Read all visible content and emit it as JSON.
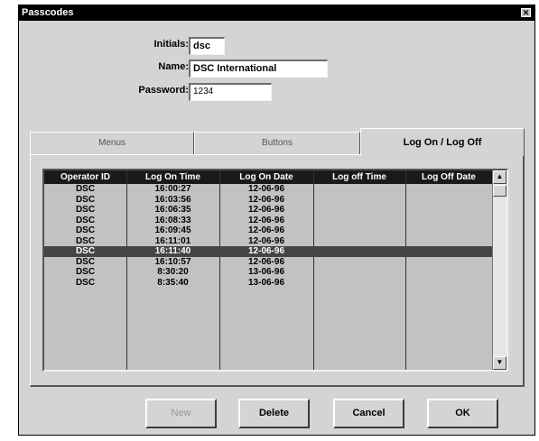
{
  "window": {
    "title": "Passcodes",
    "close_glyph": "✕"
  },
  "form": {
    "initials_label": "Initials:",
    "initials_value": "dsc",
    "name_label": "Name:",
    "name_value": "DSC International",
    "password_label": "Password:",
    "password_value": "1234"
  },
  "tabs": [
    {
      "label": "Menus",
      "active": false
    },
    {
      "label": "Buttons",
      "active": false
    },
    {
      "label": "Log On / Log Off",
      "active": true
    }
  ],
  "grid": {
    "columns": [
      "Operator ID",
      "Log On Time",
      "Log On Date",
      "Log off Time",
      "Log Off Date"
    ],
    "rows": [
      [
        "DSC",
        "16:00:27",
        "12-06-96",
        "",
        ""
      ],
      [
        "DSC",
        "16:03:56",
        "12-06-96",
        "",
        ""
      ],
      [
        "DSC",
        "16:06:35",
        "12-06-96",
        "",
        ""
      ],
      [
        "DSC",
        "16:08:33",
        "12-06-96",
        "",
        ""
      ],
      [
        "DSC",
        "16:09:45",
        "12-06-96",
        "",
        ""
      ],
      [
        "DSC",
        "16:11:01",
        "12-06-96",
        "",
        ""
      ],
      [
        "DSC",
        "16:11:40",
        "12-06-96",
        "",
        ""
      ],
      [
        "DSC",
        "16:10:57",
        "12-06-96",
        "",
        ""
      ],
      [
        "DSC",
        "8:30:20",
        "13-06-96",
        "",
        ""
      ],
      [
        "DSC",
        "8:35:40",
        "13-06-96",
        "",
        ""
      ]
    ],
    "selected_row": 6,
    "scroll_up_icon": "▲",
    "scroll_down_icon": "▼"
  },
  "buttons": {
    "new": "New",
    "delete": "Delete",
    "cancel": "Cancel",
    "ok": "OK"
  }
}
